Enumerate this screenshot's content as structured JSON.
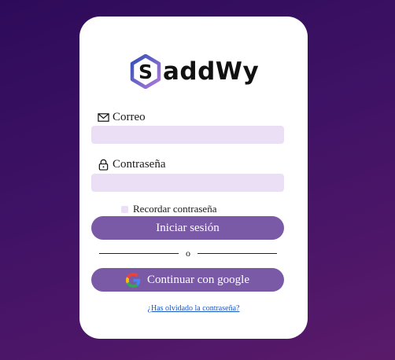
{
  "brand": {
    "logo_letter": "S",
    "name_rest": "addWy"
  },
  "form": {
    "email_label": "Correo",
    "email_value": "",
    "email_placeholder": "",
    "password_label": "Contraseña",
    "password_value": "",
    "password_placeholder": "",
    "remember_label": "Recordar contraseña",
    "login_button": "Iniciar sesión",
    "divider_text": "o",
    "google_button": "Continuar con google",
    "forgot_link": "¿Has olvidado la contraseña?"
  },
  "colors": {
    "background_top": "#2e0b5a",
    "background_bottom": "#5a1a6a",
    "card": "#ffffff",
    "input_fill": "#ebdff5",
    "button": "#7a5aa6",
    "link": "#1a55c4"
  },
  "icons": [
    "envelope-icon",
    "lock-icon",
    "google-icon",
    "hexagon-logo-icon"
  ]
}
